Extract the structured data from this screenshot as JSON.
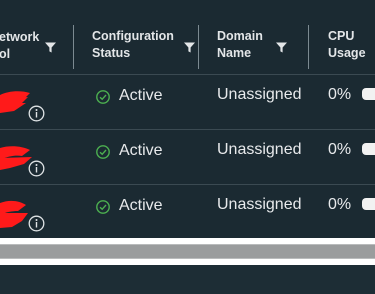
{
  "colors": {
    "background": "#1b2a32",
    "row_divider": "#3b4a52",
    "text": "#e8eaec",
    "success_green": "#4caf50",
    "redaction_red": "#ff1a1a"
  },
  "header": {
    "columns": [
      {
        "label": "etwork\nol",
        "filter_icon": "filter-icon"
      },
      {
        "label": "Configuration\nStatus",
        "filter_icon": "filter-icon"
      },
      {
        "label": "Domain\nName",
        "filter_icon": "filter-icon"
      },
      {
        "label": "CPU\nUsage"
      }
    ]
  },
  "rows": [
    {
      "status": "Active",
      "status_icon": "check-circle-icon",
      "domain": "Unassigned",
      "cpu": "0%",
      "info_icon": "info-icon"
    },
    {
      "status": "Active",
      "status_icon": "check-circle-icon",
      "domain": "Unassigned",
      "cpu": "0%",
      "info_icon": "info-icon"
    },
    {
      "status": "Active",
      "status_icon": "check-circle-icon",
      "domain": "Unassigned",
      "cpu": "0%",
      "info_icon": "info-icon"
    }
  ]
}
